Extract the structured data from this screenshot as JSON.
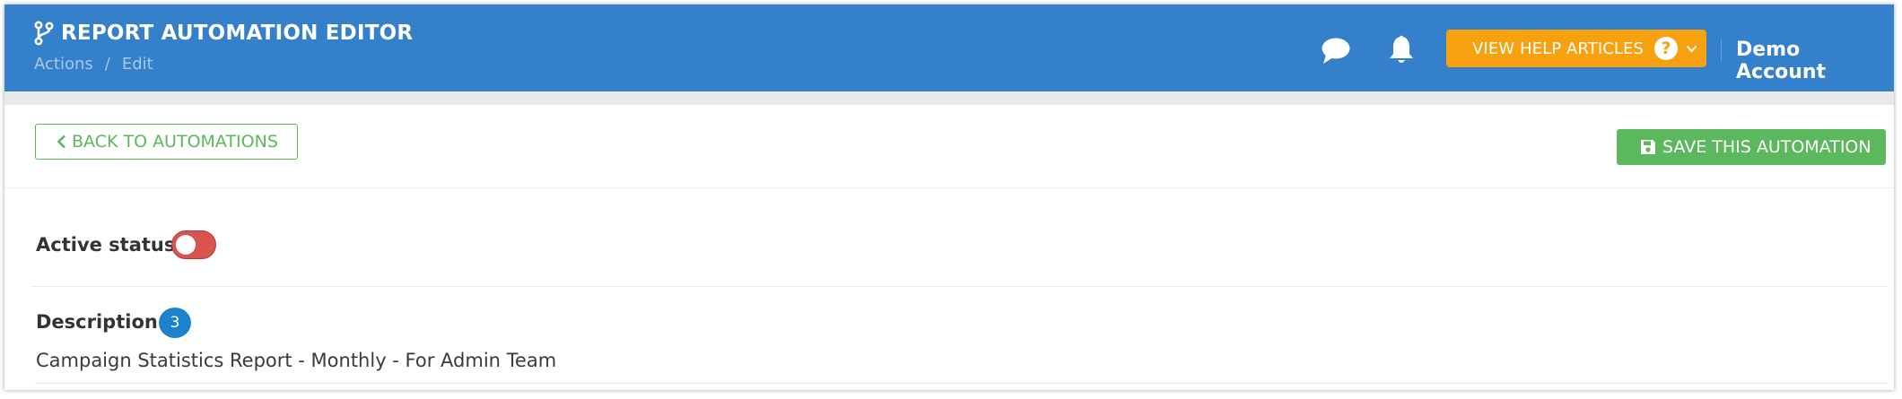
{
  "header": {
    "title": "REPORT AUTOMATION EDITOR",
    "breadcrumb": [
      "Actions",
      "Edit"
    ],
    "breadcrumb_separator": "/",
    "help_button_label": "VIEW HELP ARTICLES",
    "help_icon_glyph": "?",
    "account_name": "Demo Account",
    "icons": [
      "branch-icon",
      "chat-icon",
      "bell-icon",
      "question-icon",
      "chevron-down-icon"
    ],
    "background_color": "#3580ca",
    "help_button_color": "#f6a10d"
  },
  "toolbar": {
    "back_label": "BACK TO AUTOMATIONS",
    "save_label": "SAVE THIS AUTOMATION",
    "accent_color": "#5cb85c"
  },
  "form": {
    "active_status_label": "Active status",
    "active_status_on": false,
    "toggle_color": "#d9534f",
    "description_label": "Description",
    "description_badge": "3",
    "description_value": "Campaign Statistics Report - Monthly - For Admin Team"
  }
}
